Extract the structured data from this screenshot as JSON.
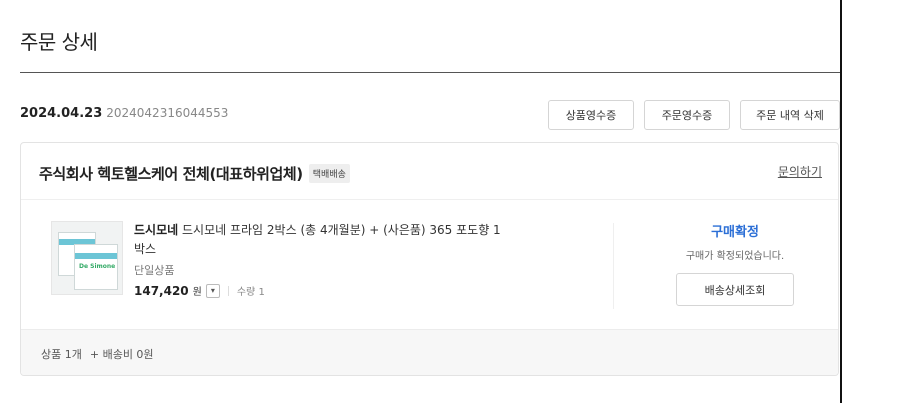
{
  "page": {
    "title": "주문 상세"
  },
  "order": {
    "date": "2024.04.23",
    "number": "2024042316044553",
    "buttons": {
      "product_receipt": "상품영수증",
      "order_receipt": "주문영수증",
      "delete_order": "주문 내역 삭제"
    }
  },
  "seller": {
    "name": "주식회사 헥토헬스케어 전체(대표하위업체)",
    "badge": "택배배송",
    "inquiry": "문의하기"
  },
  "product": {
    "brand": "드시모네",
    "title": "드시모네 프라임 2박스 (총 4개월분) + (사은품) 365 포도향 1박스",
    "option": "단일상품",
    "price": "147,420",
    "currency": "원",
    "toggle_icon": "chevron-down-icon",
    "quantity": "수량 1",
    "thumbnail_text": "De Simone"
  },
  "status": {
    "title": "구매확정",
    "description": "구매가 확정되었습니다.",
    "track_button": "배송상세조회",
    "accent": "#2c6fd6"
  },
  "summary": {
    "items": "상품 1개",
    "shipping": "+ 배송비 0원"
  }
}
